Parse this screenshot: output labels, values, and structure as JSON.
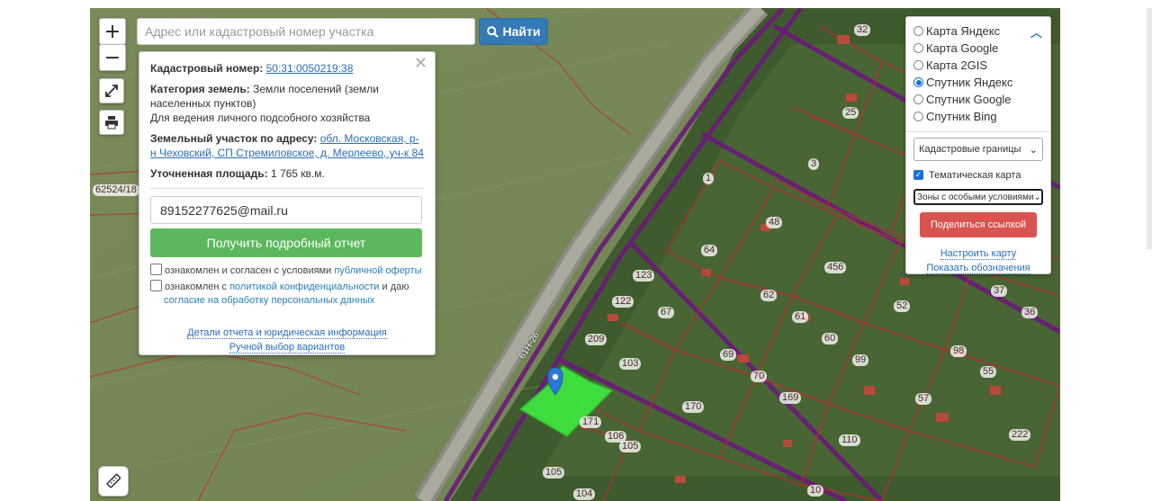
{
  "search": {
    "placeholder": "Адрес или кадастровый номер участка",
    "button_label": "Найти"
  },
  "controls": {
    "zoom_in": "+",
    "zoom_out": "−"
  },
  "popup": {
    "cadastral_label": "Кадастровый номер:",
    "cadastral_number": "50:31:0050219:38",
    "category_label": "Категория земель:",
    "category_value": "Земли поселений (земли населенных пунктов)",
    "usage": "Для ведения личного подсобного хозяйства",
    "address_label": "Земельный участок по адресу:",
    "address_value": "обл. Московская, р-н Чеховский, СП Стремиловское, д. Мерлеево, уч-к 84",
    "area_label": "Уточненная площадь:",
    "area_value": "1 765 кв.м.",
    "email_value": "89152277625@mail.ru",
    "report_button": "Получить подробный отчет",
    "consent1_text": "ознакомлен и согласен с условиями",
    "consent1_link": "публичной оферты",
    "consent2_text": "ознакомлен с",
    "consent2_link": "политикой конфиденциальности",
    "consent2_mid": "и даю",
    "consent2_link2": "согласие на обработку персональных данных",
    "details_link": "Детали отчета и юридическая информация",
    "manual_link": "Ручной выбор вариантов"
  },
  "layers": {
    "options": [
      {
        "label": "Карта Яндекс",
        "selected": false
      },
      {
        "label": "Карта Google",
        "selected": false
      },
      {
        "label": "Карта 2GIS",
        "selected": false
      },
      {
        "label": "Спутник Яндекс",
        "selected": true
      },
      {
        "label": "Спутник Google",
        "selected": false
      },
      {
        "label": "Спутник Bing",
        "selected": false
      }
    ],
    "boundaries_select": "Кадастровые границы",
    "thematic_label": "Тематическая карта",
    "thematic_checked": true,
    "zones_select": "Зоны с особыми условиями",
    "share_button": "Поделиться ссылкой",
    "configure_link": "Настроить карту",
    "legend_link": "Показать обозначения"
  },
  "map": {
    "road_label": "61Н-26",
    "plot_labels": [
      "62524/18",
      "32",
      "25",
      "3",
      "1",
      "48",
      "64",
      "456",
      "62",
      "123",
      "122",
      "67",
      "61",
      "60",
      "52",
      "37",
      "36",
      "209",
      "103",
      "69",
      "70",
      "99",
      "98",
      "55",
      "57",
      "171",
      "170",
      "169",
      "106",
      "105",
      "110",
      "222",
      "105",
      "104",
      "10"
    ]
  },
  "colors": {
    "selected_plot": "#3fe83f",
    "primary": "#337ab7",
    "success": "#5cb85c",
    "danger": "#d9534f",
    "cadastral_border": "#6b1a7a"
  }
}
